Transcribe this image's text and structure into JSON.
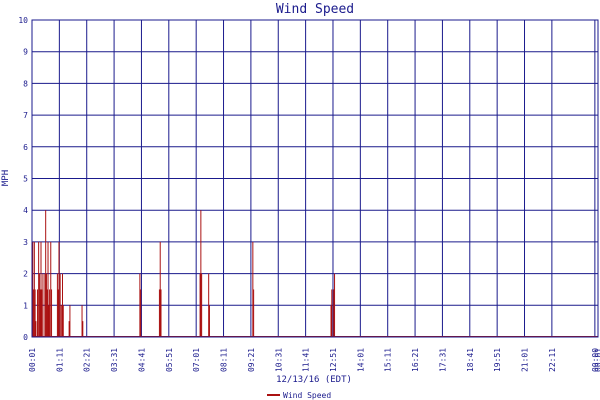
{
  "chart_data": {
    "type": "line",
    "title": "Wind Speed",
    "xlabel": "12/13/16 (EDT)",
    "ylabel": "MPH",
    "ylim": [
      0,
      10
    ],
    "y_ticks": [
      "0",
      "1",
      "2",
      "3",
      "4",
      "5",
      "6",
      "7",
      "8",
      "9",
      "10"
    ],
    "x_range_minutes": [
      0,
      1448
    ],
    "x_ticks": [
      {
        "label": "00:01",
        "m": 0
      },
      {
        "label": "01:11",
        "m": 70
      },
      {
        "label": "02:21",
        "m": 140
      },
      {
        "label": "03:31",
        "m": 210
      },
      {
        "label": "04:41",
        "m": 280
      },
      {
        "label": "05:51",
        "m": 350
      },
      {
        "label": "07:01",
        "m": 420
      },
      {
        "label": "08:11",
        "m": 490
      },
      {
        "label": "09:21",
        "m": 560
      },
      {
        "label": "10:31",
        "m": 630
      },
      {
        "label": "11:41",
        "m": 700
      },
      {
        "label": "12:51",
        "m": 770
      },
      {
        "label": "14:01",
        "m": 840
      },
      {
        "label": "15:11",
        "m": 910
      },
      {
        "label": "16:21",
        "m": 980
      },
      {
        "label": "17:31",
        "m": 1050
      },
      {
        "label": "18:41",
        "m": 1120
      },
      {
        "label": "19:51",
        "m": 1190
      },
      {
        "label": "21:01",
        "m": 1260
      },
      {
        "label": "22:11",
        "m": 1330
      },
      {
        "label": "00:00",
        "m": 1440
      },
      {
        "label": "00:01",
        "m": 1448
      }
    ],
    "grid": true,
    "legend": "bottom-center",
    "series": [
      {
        "name": "Wind Speed",
        "color": "#aa1111",
        "spikes": [
          [
            1,
            1.5
          ],
          [
            2,
            3
          ],
          [
            4,
            1.5
          ],
          [
            6,
            3
          ],
          [
            8,
            1.5
          ],
          [
            10,
            0.5
          ],
          [
            14,
            1.5
          ],
          [
            17,
            3
          ],
          [
            19,
            2
          ],
          [
            21,
            1.5
          ],
          [
            23,
            3
          ],
          [
            25,
            1.5
          ],
          [
            28,
            2
          ],
          [
            33,
            2
          ],
          [
            35,
            4
          ],
          [
            37,
            2
          ],
          [
            39,
            1.5
          ],
          [
            41,
            3
          ],
          [
            43,
            1
          ],
          [
            45,
            1.5
          ],
          [
            48,
            3
          ],
          [
            50,
            1.5
          ],
          [
            65,
            2
          ],
          [
            67,
            1.5
          ],
          [
            69,
            3
          ],
          [
            72,
            2
          ],
          [
            75,
            1
          ],
          [
            78,
            2
          ],
          [
            80,
            1
          ],
          [
            95,
            0.5
          ],
          [
            97,
            1
          ],
          [
            128,
            1
          ],
          [
            130,
            0.5
          ],
          [
            276,
            2
          ],
          [
            278,
            1.5
          ],
          [
            326,
            1.5
          ],
          [
            328,
            3
          ],
          [
            330,
            1.5
          ],
          [
            430,
            2
          ],
          [
            432,
            4
          ],
          [
            434,
            2
          ],
          [
            452,
            2
          ],
          [
            454,
            1
          ],
          [
            565,
            3
          ],
          [
            567,
            1.5
          ],
          [
            765,
            1
          ],
          [
            767,
            1.5
          ],
          [
            772,
            1.5
          ],
          [
            774,
            2
          ]
        ]
      }
    ]
  }
}
